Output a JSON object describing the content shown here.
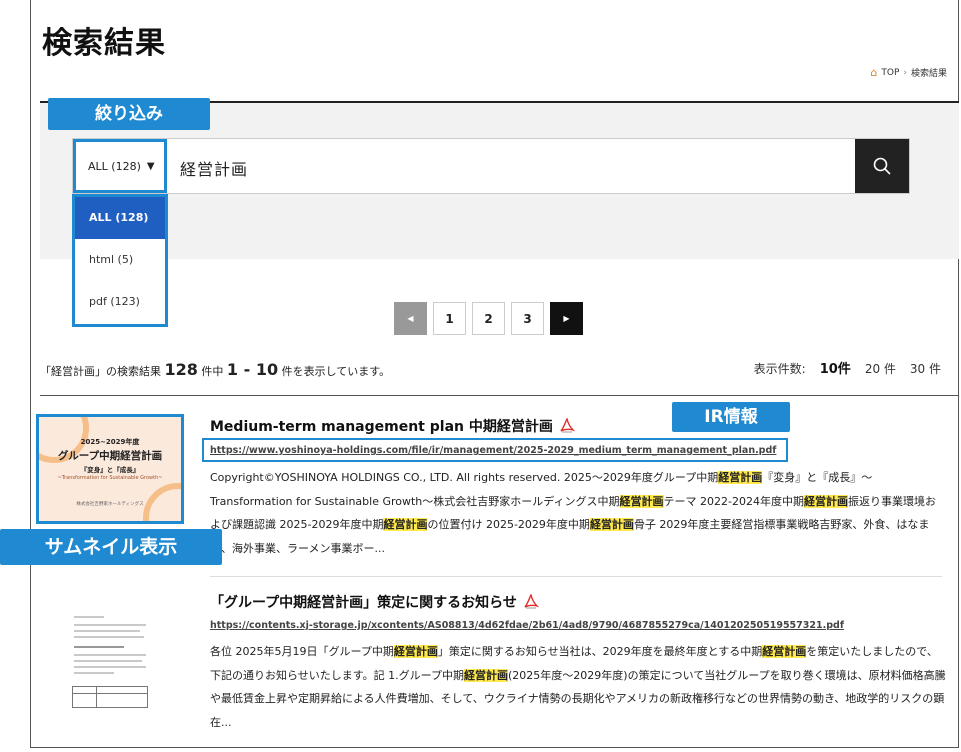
{
  "page": {
    "title": "検索結果"
  },
  "breadcrumb": {
    "home": "TOP",
    "current": "検索結果"
  },
  "callouts": {
    "filter": "絞り込み",
    "ir": "IR情報",
    "thumbnail": "サムネイル表示"
  },
  "search": {
    "filter_selected": "ALL (128)",
    "query": "経営計画",
    "options": [
      "ALL (128)",
      "html (5)",
      "pdf (123)"
    ]
  },
  "pagination": {
    "pages": [
      "1",
      "2",
      "3"
    ]
  },
  "summary": {
    "prefix": "「経営計画」の検索結果",
    "total": "128",
    "mid": "件中",
    "range": "1 - 10",
    "suffix": "件を表示しています。",
    "per_page_label": "表示件数:",
    "per_page_options": [
      "10件",
      "20 件",
      "30 件"
    ]
  },
  "results": [
    {
      "title": "Medium-term management plan 中期経営計画",
      "url": "https://www.yoshinoya-holdings.com/file/ir/management/2025-2029_medium_term_management_plan.pdf",
      "thumb": {
        "years": "2025~2029年度",
        "heading": "グループ中期経営計画",
        "subtitle": "『変身』と『成長』",
        "tagline": "~Transformation for Sustainable Growth~",
        "company": "株式会社吉野家ホールディングス"
      },
      "desc": [
        "Copyright©YOSHINOYA HOLDINGS CO., LTD. All rights reserved. 2025～2029年度グループ中期",
        "経営計画",
        "『変身』と『成長』～Transformation for Sustainable Growth～株式会社吉野家ホールディングス中期",
        "経営計画",
        "テーマ 2022-2024年度中期",
        "経営計画",
        "振返り事業環境および課題認識 2025-2029年度中期",
        "経営計画",
        "の位置付け 2025-2029年度中期",
        "経営計画",
        "骨子 2029年度主要経営指標事業戦略吉野家、外食、はなまる、海外事業、ラーメン事業ボー..."
      ]
    },
    {
      "title": "「グループ中期経営計画」策定に関するお知らせ",
      "url": "https://contents.xj-storage.jp/xcontents/AS08813/4d62fdae/2b61/4ad8/9790/4687855279ca/140120250519557321.pdf",
      "desc": [
        "各位 2025年5月19日「グループ中期",
        "経営計画",
        "」策定に関するお知らせ当社は、2029年度を最終年度とする中期",
        "経営計画",
        "を策定いたしましたので、下記の通りお知らせいたします。記 1.グループ中期",
        "経営計画",
        "(2025年度～2029年度)の策定について当社グループを取り巻く環境は、原材料価格高騰や最低賃金上昇や定期昇給による人件費増加、そして、ウクライナ情勢の長期化やアメリカの新政権移行などの世界情勢の動き、地政学的リスクの顕在..."
      ]
    }
  ],
  "colors": {
    "accent": "#1f8ad1",
    "highlight": "#ffe94d",
    "active_option": "#1f5fc1",
    "pdf": "#e02b2b"
  },
  "icons": {
    "home": "home-icon",
    "search": "search-icon",
    "pdf": "pdf-icon",
    "prev": "prev-arrow-icon",
    "next": "next-arrow-icon"
  }
}
